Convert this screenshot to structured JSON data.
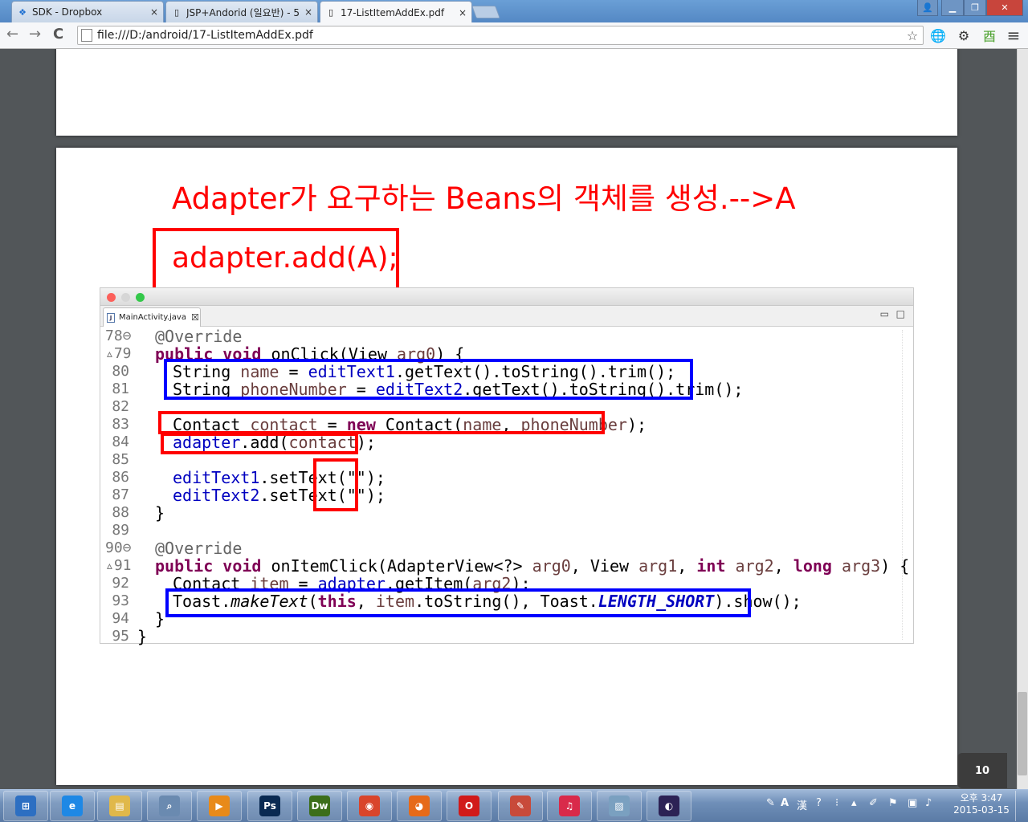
{
  "browser": {
    "tabs": [
      {
        "label": "SDK - Dropbox",
        "icon": "dropbox-icon",
        "active": false
      },
      {
        "label": "JSP+Andorid (일요반) - 5",
        "icon": "page-icon",
        "active": false
      },
      {
        "label": "17-ListItemAddEx.pdf",
        "icon": "page-icon",
        "active": true
      }
    ],
    "tab_close": "×",
    "url": "file:///D:/android/17-ListItemAddEx.pdf",
    "window_buttons": {
      "user": "👤",
      "minimize": "▁",
      "restore": "❐",
      "close": "✕"
    },
    "nav": {
      "back": "←",
      "forward": "→",
      "reload": "C"
    },
    "toolbar_icons": {
      "star": "☆",
      "globe": "🌐",
      "gear": "⚙",
      "extension": "⾣",
      "menu": "≡"
    }
  },
  "pdf": {
    "page_number": "10"
  },
  "slide": {
    "heading": "Adapter가 요구하는 Beans의 객체를 생성.-->A",
    "code_line": "adapter.add(A);"
  },
  "editor": {
    "tab_label": "MainActivity.java",
    "tab_close": "☒",
    "minimize": "▭",
    "maximize": "□",
    "line_numbers": [
      "78⊖",
      "▵79",
      "80",
      "81",
      "82",
      "83",
      "84",
      "85",
      "86",
      "87",
      "88",
      "89",
      "90⊖",
      "▵91",
      "92",
      "93",
      "94",
      "95"
    ]
  },
  "taskbar": {
    "apps": [
      {
        "name": "start-button",
        "glyph": "⊞",
        "color": "#2d6fc2"
      },
      {
        "name": "internet-explorer-icon",
        "glyph": "e",
        "color": "#1e88e5"
      },
      {
        "name": "file-explorer-icon",
        "glyph": "▤",
        "color": "#e0b84a"
      },
      {
        "name": "search-tool-icon",
        "glyph": "⌕",
        "color": "#6a8ab0"
      },
      {
        "name": "media-player-icon",
        "glyph": "▶",
        "color": "#e88a1a"
      },
      {
        "name": "photoshop-icon",
        "glyph": "Ps",
        "color": "#0a2a52"
      },
      {
        "name": "dreamweaver-icon",
        "glyph": "Dw",
        "color": "#3c6e1a"
      },
      {
        "name": "chrome-icon",
        "glyph": "◉",
        "color": "#d9452b"
      },
      {
        "name": "firefox-icon",
        "glyph": "◕",
        "color": "#e66a1a"
      },
      {
        "name": "opera-icon",
        "glyph": "O",
        "color": "#d11a1a"
      },
      {
        "name": "notepad-app-icon",
        "glyph": "✎",
        "color": "#c84a3a"
      },
      {
        "name": "itunes-icon",
        "glyph": "♫",
        "color": "#d92a4a"
      },
      {
        "name": "notes-app-icon",
        "glyph": "▨",
        "color": "#7aa0c0"
      },
      {
        "name": "eclipse-icon",
        "glyph": "◐",
        "color": "#2c2255"
      }
    ],
    "tray_lang": "A",
    "tray_ime": "漢",
    "clock_time": "오후 3:47",
    "clock_date": "2015-03-15"
  }
}
